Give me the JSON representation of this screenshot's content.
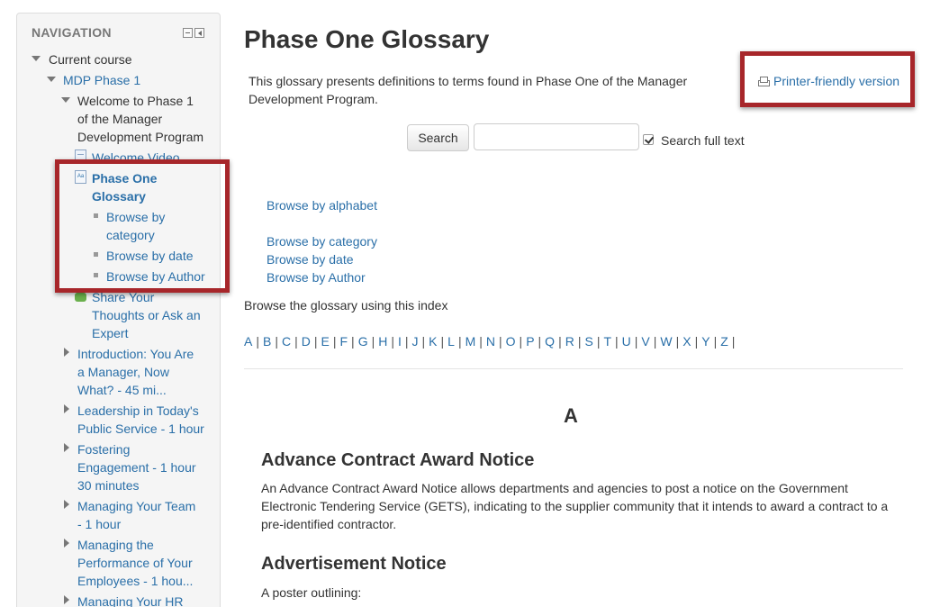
{
  "nav": {
    "title": "NAVIGATION",
    "current_course": "Current course",
    "course": "MDP Phase 1",
    "section_welcome": [
      "Welcome to Phase 1",
      "of the Manager",
      "Development Program"
    ],
    "welcome_video": "Welcome Video",
    "glossary": [
      "Phase One",
      "Glossary"
    ],
    "browse_category": [
      "Browse by",
      "category"
    ],
    "browse_date": "Browse by date",
    "browse_author": "Browse by Author",
    "share": [
      "Share Your",
      "Thoughts or Ask an",
      "Expert"
    ],
    "intro": [
      "Introduction: You Are",
      "a Manager, Now",
      "What? - 45 mi..."
    ],
    "leadership": [
      "Leadership in Today's",
      "Public Service - 1 hour"
    ],
    "fostering": [
      "Fostering",
      "Engagement - 1 hour",
      "30 minutes"
    ],
    "team": [
      "Managing Your Team",
      "- 1 hour"
    ],
    "performance": [
      "Managing the",
      "Performance of Your",
      "Employees - 1 hou..."
    ],
    "hr": [
      "Managing Your HR"
    ]
  },
  "main": {
    "title": "Phase One Glossary",
    "intro": "This glossary presents definitions to terms found in Phase One of the Manager Development Program.",
    "printer_link": "Printer-friendly version",
    "search_button": "Search",
    "search_placeholder": "",
    "fulltext_label": "Search full text",
    "browse_alphabet": "Browse by alphabet",
    "browse_category": "Browse by category",
    "browse_date": "Browse by date",
    "browse_author": "Browse by Author",
    "index_text": "Browse the glossary using this index",
    "letters": [
      "A",
      "B",
      "C",
      "D",
      "E",
      "F",
      "G",
      "H",
      "I",
      "J",
      "K",
      "L",
      "M",
      "N",
      "O",
      "P",
      "Q",
      "R",
      "S",
      "T",
      "U",
      "V",
      "W",
      "X",
      "Y",
      "Z"
    ],
    "section_letter": "A",
    "entries": [
      {
        "term": "Advance Contract Award Notice",
        "definition": "An Advance Contract Award Notice allows departments and agencies to post a notice on the Government Electronic Tendering Service (GETS), indicating to the supplier community that it intends to award a contract to a pre-identified contractor."
      },
      {
        "term": "Advertisement Notice",
        "definition": "A poster outlining:"
      }
    ]
  },
  "colors": {
    "link": "#2a6fa8",
    "highlight": "#a7262a",
    "nav_bg": "#f5f5f5"
  }
}
